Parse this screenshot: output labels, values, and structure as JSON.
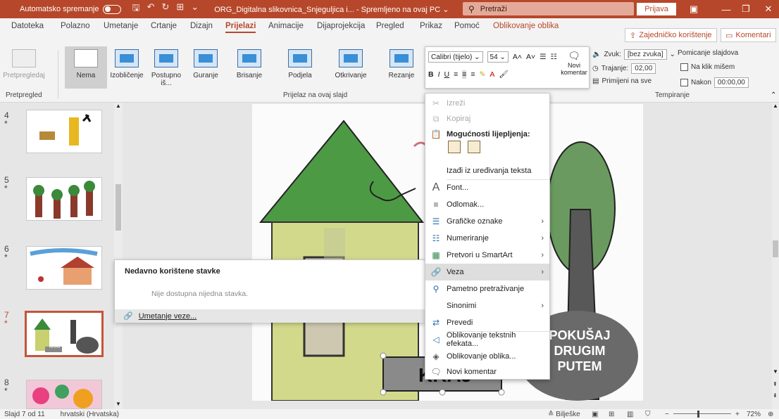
{
  "titlebar": {
    "autosave_label": "Automatsko spremanje",
    "document_title": "ORG_Digitalna slikovnica_Snjeguljica i...  -  Spremljeno na ovaj PC ⌄",
    "search_placeholder": "Pretraži",
    "signin_label": "Prijava"
  },
  "tabs": [
    {
      "label": "Datoteka"
    },
    {
      "label": "Polazno"
    },
    {
      "label": "Umetanje"
    },
    {
      "label": "Crtanje"
    },
    {
      "label": "Dizajn"
    },
    {
      "label": "Prijelazi"
    },
    {
      "label": "Animacije"
    },
    {
      "label": "Dijaprojekcija"
    },
    {
      "label": "Pregled"
    },
    {
      "label": "Prikaz"
    },
    {
      "label": "Pomoć"
    },
    {
      "label": "Oblikovanje oblika"
    }
  ],
  "share_label": "Zajedničko korištenje",
  "comments_label": "Komentari",
  "ribbon": {
    "preview_label": "Pretpregledaj",
    "preview_group": "Pretpregled",
    "transitions": [
      "Nema",
      "Izobličenje",
      "Postupno iš...",
      "Guranje",
      "Brisanje",
      "Podjela",
      "Otkrivanje",
      "Rezanje"
    ],
    "transitions_group": "Prijelaz na ovaj slajd",
    "timing_group": "Tempiranje",
    "sound_label": "Zvuk:",
    "sound_value": "[bez zvuka]",
    "duration_label": "Trajanje:",
    "duration_value": "02,00",
    "apply_all_label": "Primijeni na sve",
    "advance_label": "Pomicanje slajdova",
    "on_click_label": "Na klik mišem",
    "after_label": "Nakon",
    "after_value": "00:00,00"
  },
  "minibar": {
    "font": "Calibri (tijelo)",
    "size": "54",
    "new_comment": "Novi komentar"
  },
  "slides": [
    {
      "number": "4",
      "star": "*"
    },
    {
      "number": "5",
      "star": "*"
    },
    {
      "number": "6",
      "star": "*"
    },
    {
      "number": "7",
      "star": "*"
    },
    {
      "number": "8",
      "star": "*"
    }
  ],
  "thumb7_label": "KRAJ",
  "slide": {
    "textbox": "KRAJ",
    "oval_text": [
      "POKUŠAJ",
      "DRUGIM",
      "PUTEM"
    ]
  },
  "recent": {
    "header": "Nedavno korištene stavke",
    "empty": "Nije dostupna nijedna stavka.",
    "insert_link": "Umetanje veze..."
  },
  "context_menu": [
    {
      "label": "Izreži",
      "icon": "cut-icon"
    },
    {
      "label": "Kopiraj",
      "icon": "copy-icon"
    },
    {
      "label": "Mogućnosti lijepljenja:",
      "icon": "paste-icon"
    },
    {
      "label": "Izađi iz uređivanja teksta",
      "icon": ""
    },
    {
      "label": "Font...",
      "icon": "font-icon"
    },
    {
      "label": "Odlomak...",
      "icon": "paragraph-icon"
    },
    {
      "label": "Grafičke oznake",
      "icon": "bullets-icon"
    },
    {
      "label": "Numeriranje",
      "icon": "numbering-icon"
    },
    {
      "label": "Pretvori u SmartArt",
      "icon": "smartart-icon"
    },
    {
      "label": "Veza",
      "icon": "link-icon"
    },
    {
      "label": "Pametno pretraživanje",
      "icon": "smart-search-icon"
    },
    {
      "label": "Sinonimi",
      "icon": ""
    },
    {
      "label": "Prevedi",
      "icon": "translate-icon"
    },
    {
      "label": "Oblikovanje tekstnih efekata...",
      "icon": "text-effects-icon"
    },
    {
      "label": "Oblikovanje oblika...",
      "icon": "format-shape-icon"
    },
    {
      "label": "Novi komentar",
      "icon": "comment-icon"
    }
  ],
  "status": {
    "slide_info": "Slajd 7 od 11",
    "language": "hrvatski (Hrvatska)",
    "notes": "Bilješke",
    "zoom": "72%"
  },
  "colors": {
    "accent": "#b7472a",
    "hover": "#dedede"
  }
}
